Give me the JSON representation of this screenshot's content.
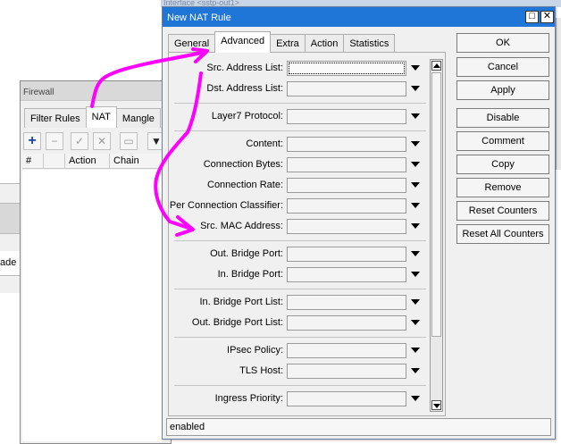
{
  "background": {
    "top_window_title": "Interface <sstp-out1>",
    "partial_text": "ade",
    "firewall": {
      "title": "Firewall",
      "tabs": [
        {
          "label": "Filter Rules",
          "active": false
        },
        {
          "label": "NAT",
          "active": true
        },
        {
          "label": "Mangle",
          "active": false
        }
      ],
      "toolbar_icons": [
        "plus-icon",
        "minus-icon",
        "check-icon",
        "cross-icon",
        "comment-icon",
        "filter-icon"
      ],
      "columns": [
        "#",
        "Action",
        "Chain"
      ]
    }
  },
  "dialog": {
    "title": "New NAT Rule",
    "tabs": [
      {
        "label": "General",
        "active": false
      },
      {
        "label": "Advanced",
        "active": true
      },
      {
        "label": "Extra",
        "active": false
      },
      {
        "label": "Action",
        "active": false
      },
      {
        "label": "Statistics",
        "active": false
      }
    ],
    "fields": [
      {
        "name": "src-address-list",
        "label": "Src. Address List:",
        "value": "",
        "focused": true
      },
      {
        "name": "dst-address-list",
        "label": "Dst. Address List:",
        "value": ""
      },
      {
        "name": "layer7-protocol",
        "label": "Layer7 Protocol:",
        "value": ""
      },
      {
        "name": "content",
        "label": "Content:",
        "value": ""
      },
      {
        "name": "connection-bytes",
        "label": "Connection Bytes:",
        "value": ""
      },
      {
        "name": "connection-rate",
        "label": "Connection Rate:",
        "value": ""
      },
      {
        "name": "per-connection-classifier",
        "label": "Per Connection Classifier:",
        "value": ""
      },
      {
        "name": "src-mac-address",
        "label": "Src. MAC Address:",
        "value": ""
      },
      {
        "name": "out-bridge-port",
        "label": "Out. Bridge Port:",
        "value": ""
      },
      {
        "name": "in-bridge-port",
        "label": "In. Bridge Port:",
        "value": ""
      },
      {
        "name": "in-bridge-port-list",
        "label": "In. Bridge Port List:",
        "value": ""
      },
      {
        "name": "out-bridge-port-list",
        "label": "Out. Bridge Port List:",
        "value": ""
      },
      {
        "name": "ipsec-policy",
        "label": "IPsec Policy:",
        "value": ""
      },
      {
        "name": "tls-host",
        "label": "TLS Host:",
        "value": ""
      },
      {
        "name": "ingress-priority",
        "label": "Ingress Priority:",
        "value": ""
      }
    ],
    "buttons": [
      {
        "name": "ok",
        "label": "OK"
      },
      {
        "name": "cancel",
        "label": "Cancel"
      },
      {
        "name": "apply",
        "label": "Apply"
      },
      {
        "name": "disable",
        "label": "Disable"
      },
      {
        "name": "comment",
        "label": "Comment"
      },
      {
        "name": "copy",
        "label": "Copy"
      },
      {
        "name": "remove",
        "label": "Remove"
      },
      {
        "name": "reset-counters",
        "label": "Reset Counters"
      },
      {
        "name": "reset-all-counters",
        "label": "Reset All Counters"
      }
    ],
    "status": "enabled"
  },
  "colors": {
    "titlebar": "#1f76d6",
    "annotation": "#ff00ff"
  }
}
